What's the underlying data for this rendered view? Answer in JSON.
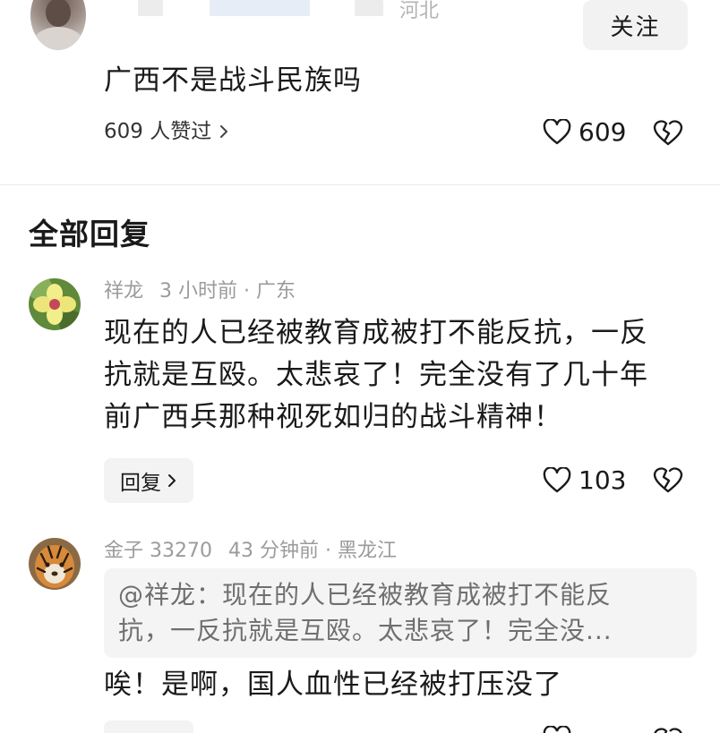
{
  "parent_comment": {
    "region": "河北",
    "follow_label": "关注",
    "text": "广西不是战斗民族吗",
    "likers_label": "609 人赞过",
    "like_count": "609"
  },
  "section_title": "全部回复",
  "replies": [
    {
      "user": "祥龙",
      "time": "3 小时前",
      "separator": "·",
      "region": "广东",
      "text_lines": [
        "现在的人已经被教育成被打不能反抗，一反",
        "抗就是互殴。太悲哀了！完全没有了几十年",
        "前广西兵那种视死如归的战斗精神！"
      ],
      "reply_label": "回复",
      "like_count": "103"
    },
    {
      "user": "金子 33270",
      "time": "43 分钟前",
      "separator": "·",
      "region": "黑龙江",
      "quote_lines": [
        "@祥龙：现在的人已经被教育成被打不能反",
        "抗，一反抗就是互殴。太悲哀了！完全没..."
      ],
      "text": "唉！是啊，国人血性已经被打压没了"
    }
  ],
  "colors": {
    "text": "#1a1a1a",
    "muted": "#9b9b9b",
    "button_bg": "#f2f2f2",
    "quote_bg": "#f4f4f4"
  },
  "icons": {
    "like": "heart-outline-icon",
    "dislike": "broken-heart-icon",
    "chevron": "chevron-right-icon"
  }
}
